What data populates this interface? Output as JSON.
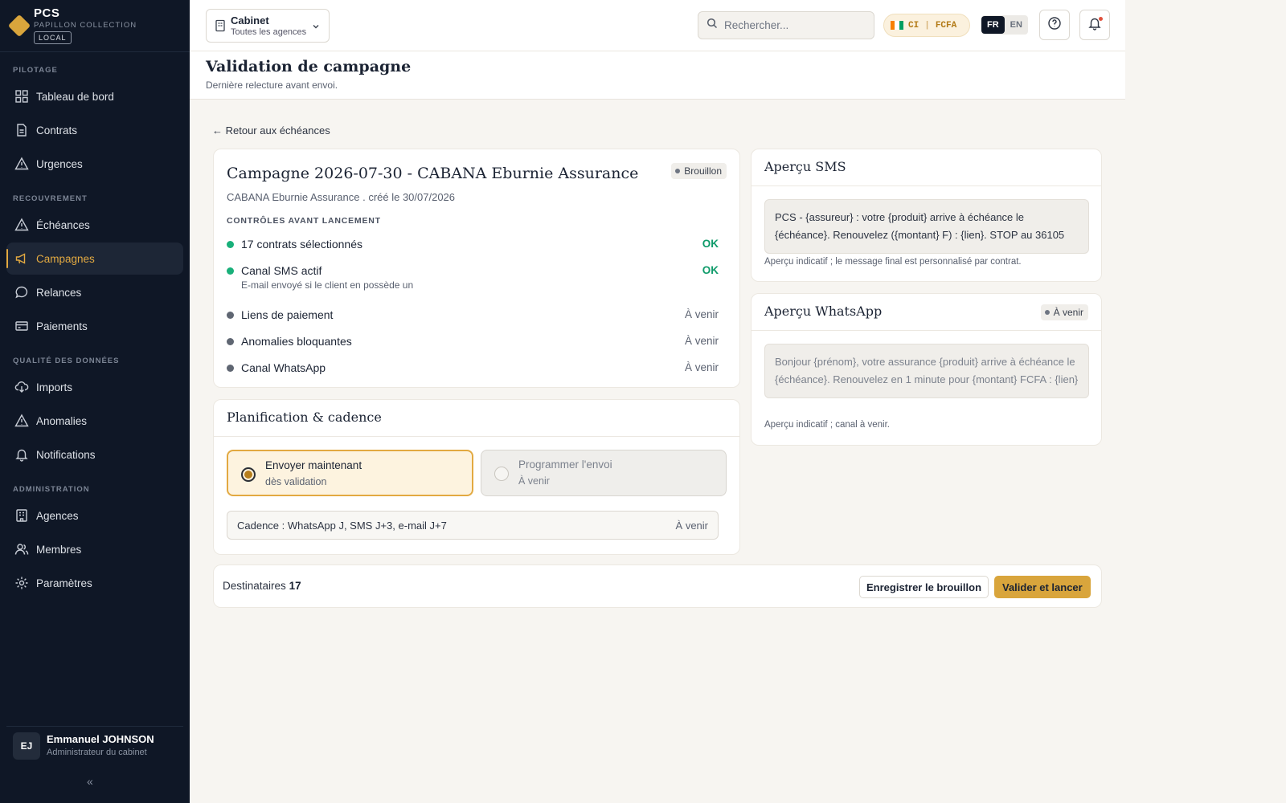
{
  "brand": {
    "name": "PCS",
    "subtitle": "PAPILLON COLLECTION",
    "env": "LOCAL"
  },
  "sidebar": {
    "sections": [
      "PILOTAGE",
      "RECOUVREMENT",
      "QUALITÉ DES DONNÉES",
      "ADMINISTRATION"
    ],
    "items": [
      {
        "label": "Tableau de bord",
        "icon": "grid-icon"
      },
      {
        "label": "Contrats",
        "icon": "document-icon"
      },
      {
        "label": "Urgences",
        "icon": "warning-icon"
      },
      {
        "label": "Échéances",
        "icon": "warning-icon"
      },
      {
        "label": "Campagnes",
        "icon": "megaphone-icon",
        "active": true
      },
      {
        "label": "Relances",
        "icon": "chat-icon"
      },
      {
        "label": "Paiements",
        "icon": "card-icon"
      },
      {
        "label": "Imports",
        "icon": "cloud-download-icon"
      },
      {
        "label": "Anomalies",
        "icon": "warning-icon"
      },
      {
        "label": "Notifications",
        "icon": "bell-icon"
      },
      {
        "label": "Agences",
        "icon": "building-icon"
      },
      {
        "label": "Membres",
        "icon": "users-icon"
      },
      {
        "label": "Paramètres",
        "icon": "gear-icon"
      }
    ],
    "collapse": "«"
  },
  "user": {
    "initials": "EJ",
    "name": "Emmanuel JOHNSON",
    "role": "Administrateur du cabinet"
  },
  "topbar": {
    "agency_title": "Cabinet",
    "agency_sub": "Toutes les agences",
    "search_placeholder": "Rechercher...",
    "country": "CI",
    "currency": "FCFA",
    "separator": "|",
    "lang_active": "FR",
    "lang_other": "EN"
  },
  "page": {
    "title": "Validation de campagne",
    "subtitle": "Dernière relecture avant envoi.",
    "back": "← Retour aux échéances"
  },
  "campaign": {
    "title": "Campagne 2026-07-30 - CABANA Eburnie Assurance",
    "status": "Brouillon",
    "subtitle": "CABANA Eburnie Assurance . créé le 30/07/2026",
    "checks_label": "CONTRÔLES AVANT LANCEMENT",
    "checks": [
      {
        "label": "17 contrats sélectionnés",
        "status": "OK"
      },
      {
        "label": "Canal SMS actif",
        "status": "OK",
        "note": "E-mail envoyé si le client en possède un"
      },
      {
        "label": "Liens de paiement",
        "status": "À venir"
      },
      {
        "label": "Anomalies bloquantes",
        "status": "À venir"
      },
      {
        "label": "Canal WhatsApp",
        "status": "À venir"
      }
    ]
  },
  "planning": {
    "title": "Planification & cadence",
    "option_now": {
      "title": "Envoyer maintenant",
      "sub": "dès validation"
    },
    "option_schedule": {
      "title": "Programmer l'envoi",
      "sub": "À venir"
    },
    "cadence": "Cadence : WhatsApp J, SMS J+3, e-mail J+7",
    "cadence_status": "À venir"
  },
  "sms": {
    "title": "Aperçu SMS",
    "message": "PCS - {assureur} : votre {produit} arrive à échéance le {échéance}. Renouvelez ({montant} F) : {lien}. STOP au 36105",
    "note": "Aperçu indicatif ; le message final est personnalisé par contrat."
  },
  "whatsapp": {
    "title": "Aperçu WhatsApp",
    "status": "À venir",
    "message": "Bonjour {prénom}, votre assurance {produit} arrive à échéance le {échéance}. Renouvelez en 1 minute pour {montant} FCFA : {lien}",
    "note": "Aperçu indicatif ; canal à venir."
  },
  "footer": {
    "recipients_label": "Destinataires",
    "recipients_count": "17",
    "draft_button": "Enregistrer le brouillon",
    "launch_button": "Valider et lancer"
  },
  "colors": {
    "accent": "#d9a53c",
    "sidebar_bg": "#0f1726",
    "ok": "#0f9b6a"
  }
}
